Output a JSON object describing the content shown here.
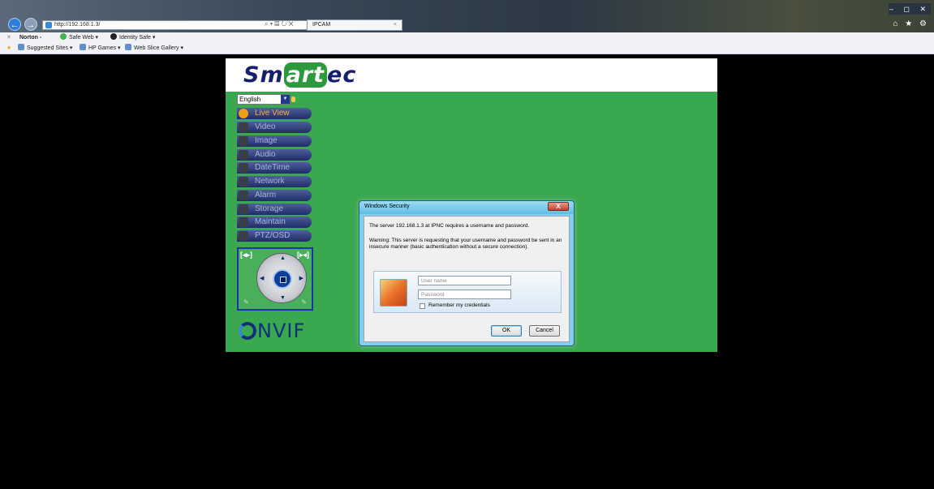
{
  "browser": {
    "url": "http://192.168.1.3/",
    "address_tools": "⌕ ▾ ▤ ↻ ✕",
    "tab_title": "IPCAM",
    "tab_close": "×",
    "window_controls": "– ◻ ✕",
    "right_icons": "⌂ ★ ⚙",
    "norton_toolbar": {
      "close": "✕",
      "brand": "Norton -",
      "safe_web": "Safe Web ▾",
      "identity_safe": "Identity Safe ▾"
    },
    "favorites": {
      "suggested_sites": "Suggested Sites ▾",
      "hp_games": "HP Games ▾",
      "web_slice_gallery": "Web Slice Gallery ▾"
    }
  },
  "camera_page": {
    "logo": {
      "left": "Sm",
      "middle": "art",
      "right": "ec"
    },
    "language": "English",
    "menu": [
      {
        "label": "Live View",
        "active": true
      },
      {
        "label": "Video"
      },
      {
        "label": "Image"
      },
      {
        "label": "Audio"
      },
      {
        "label": "DateTime"
      },
      {
        "label": "Network"
      },
      {
        "label": "Alarm"
      },
      {
        "label": "Storage"
      },
      {
        "label": "Maintain"
      },
      {
        "label": "PTZ/OSD"
      }
    ],
    "ptz": {
      "zoom_out": "[◂▸]",
      "zoom_in": "[▸◂]"
    },
    "onvif_text": "NVIF"
  },
  "dialog": {
    "title": "Windows Security",
    "close_label": "X",
    "message": "The server 192.168.1.3 at IPNC requires a username and password.",
    "warning": "Warning: This server is requesting that your username and password be sent in an insecure manner (basic authentication without a secure connection).",
    "username_placeholder": "User name",
    "password_placeholder": "Password",
    "remember_label": "Remember my credentials",
    "ok_label": "OK",
    "cancel_label": "Cancel"
  },
  "colors": {
    "page_green": "#39a84f",
    "menu_blue": "#1f2d66",
    "active_menu_text": "#ffae3a",
    "dialog_frame": "#7fd0f0"
  }
}
